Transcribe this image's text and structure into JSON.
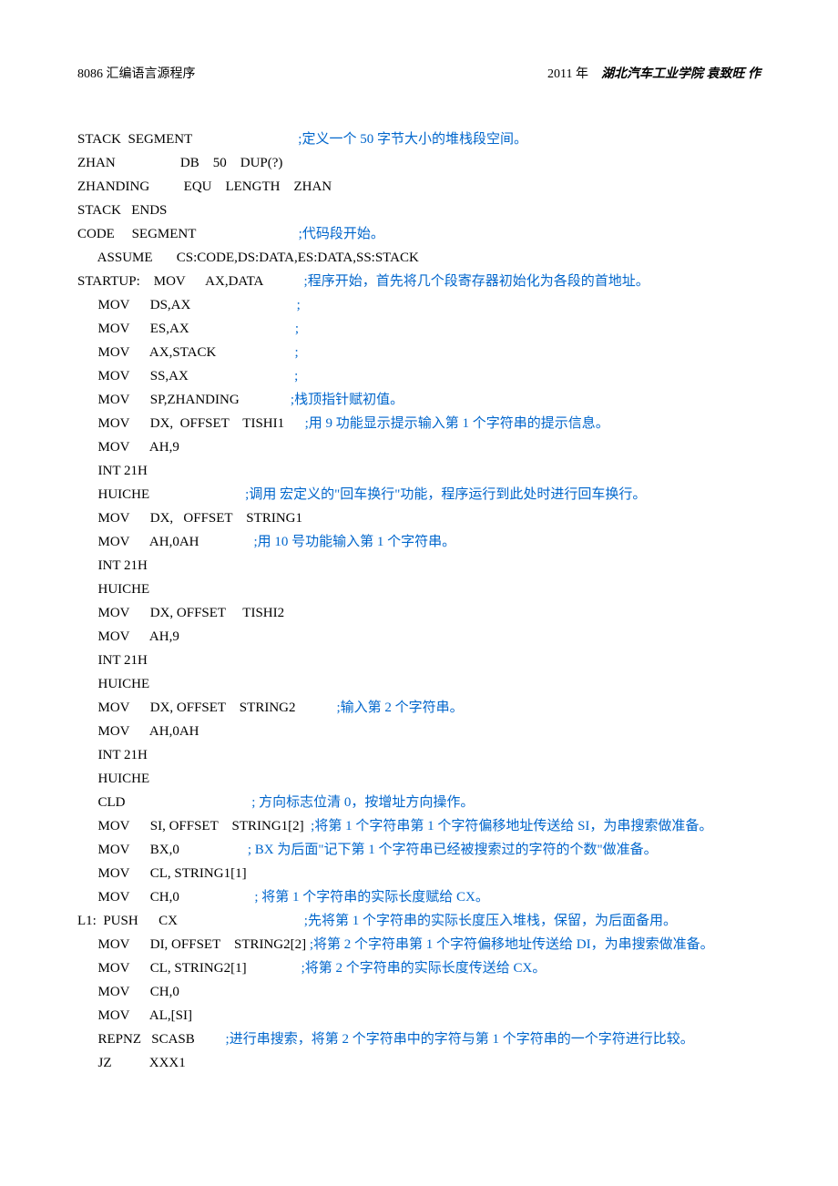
{
  "header": {
    "left": "8086 汇编语言源程序",
    "year": "2011 年",
    "org": "湖北汽车工业学院    袁致旺    作"
  },
  "lines": [
    {
      "code": "STACK  SEGMENT                               ",
      "comment": ";定义一个 50 字节大小的堆栈段空间。"
    },
    {
      "code": "ZHAN                   DB    50    DUP(?)",
      "comment": ""
    },
    {
      "code": "ZHANDING          EQU    LENGTH    ZHAN",
      "comment": ""
    },
    {
      "code": "STACK   ENDS",
      "comment": ""
    },
    {
      "code": "",
      "comment": ""
    },
    {
      "code": "CODE     SEGMENT                              ",
      "comment": ";代码段开始。"
    },
    {
      "code": "      ASSUME       CS:CODE,DS:DATA,ES:DATA,SS:STACK",
      "comment": ""
    },
    {
      "code": "STARTUP:    MOV      AX,DATA            ",
      "comment": ";程序开始，首先将几个段寄存器初始化为各段的首地址。"
    },
    {
      "code": "      MOV      DS,AX                               ",
      "comment": ";"
    },
    {
      "code": "      MOV      ES,AX                               ",
      "comment": ";"
    },
    {
      "code": "      MOV      AX,STACK                       ",
      "comment": ";"
    },
    {
      "code": "      MOV      SS,AX                               ",
      "comment": ";"
    },
    {
      "code": "      MOV      SP,ZHANDING               ",
      "comment": ";栈顶指针赋初值。"
    },
    {
      "code": "",
      "comment": ""
    },
    {
      "code": "      MOV      DX,  OFFSET    TISHI1      ",
      "comment": ";用 9 功能显示提示输入第 1 个字符串的提示信息。"
    },
    {
      "code": "      MOV      AH,9",
      "comment": ""
    },
    {
      "code": "      INT 21H",
      "comment": ""
    },
    {
      "code": "      HUICHE                            ",
      "comment": ";调用 宏定义的\"回车换行\"功能，程序运行到此处时进行回车换行。"
    },
    {
      "code": "      MOV      DX,   OFFSET    STRING1",
      "comment": ""
    },
    {
      "code": "      MOV      AH,0AH                ",
      "comment": ";用 10 号功能输入第 1 个字符串。"
    },
    {
      "code": "      INT 21H",
      "comment": ""
    },
    {
      "code": "      HUICHE",
      "comment": ""
    },
    {
      "code": "      MOV      DX, OFFSET     TISHI2",
      "comment": ""
    },
    {
      "code": "      MOV      AH,9",
      "comment": ""
    },
    {
      "code": "      INT 21H",
      "comment": ""
    },
    {
      "code": "      HUICHE",
      "comment": ""
    },
    {
      "code": "      MOV      DX, OFFSET    STRING2            ",
      "comment": ";输入第 2 个字符串。"
    },
    {
      "code": "      MOV      AH,0AH",
      "comment": ""
    },
    {
      "code": "      INT 21H",
      "comment": ""
    },
    {
      "code": "      HUICHE",
      "comment": ""
    },
    {
      "code": "      CLD                                     ",
      "comment": "; 方向标志位清 0，按增址方向操作。"
    },
    {
      "code": "      MOV      SI, OFFSET    STRING1[2]  ",
      "comment": ";将第 1 个字符串第 1 个字符偏移地址传送给 SI，为串搜索做准备。"
    },
    {
      "code": "      MOV      BX,0                    ",
      "comment": "; BX 为后面\"记下第 1 个字符串已经被搜索过的字符的个数\"做准备。"
    },
    {
      "code": "      MOV      CL, STRING1[1]",
      "comment": ""
    },
    {
      "code": "      MOV      CH,0                      ",
      "comment": "; 将第 1 个字符串的实际长度赋给 CX。"
    },
    {
      "code": "",
      "comment": ""
    },
    {
      "code": "L1:  PUSH      CX                                     ",
      "comment": ";先将第 1 个字符串的实际长度压入堆栈，保留，为后面备用。"
    },
    {
      "code": "      MOV      DI, OFFSET    STRING2[2] ",
      "comment": ";将第 2 个字符串第 1 个字符偏移地址传送给 DI，为串搜索做准备。"
    },
    {
      "code": "      MOV      CL, STRING2[1]                ",
      "comment": ";将第 2 个字符串的实际长度传送给 CX。"
    },
    {
      "code": "      MOV      CH,0",
      "comment": ""
    },
    {
      "code": "      MOV      AL,[SI]",
      "comment": ""
    },
    {
      "code": "      REPNZ   SCASB         ",
      "comment": ";进行串搜索，将第 2 个字符串中的字符与第 1 个字符串的一个字符进行比较。"
    },
    {
      "code": "      JZ           XXX1",
      "comment": ""
    }
  ]
}
